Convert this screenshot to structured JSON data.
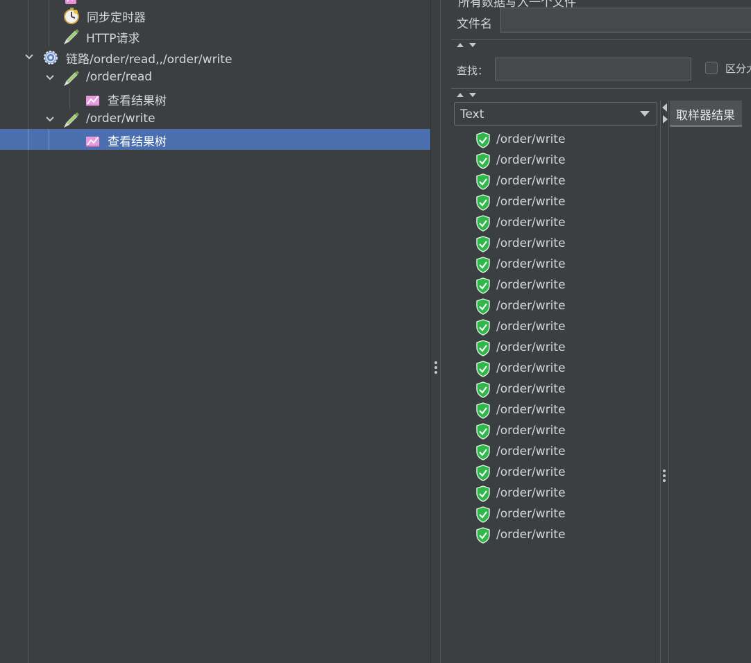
{
  "tree": {
    "nodes": [
      {
        "label": "",
        "icon": "listener-icon"
      },
      {
        "label": "同步定时器",
        "icon": "timer-icon"
      },
      {
        "label": "HTTP请求",
        "icon": "sampler-pen-icon"
      },
      {
        "label": "链路/order/read,,/order/write",
        "icon": "gear-icon",
        "expanded": true
      },
      {
        "label": "/order/read",
        "icon": "sampler-pen-icon",
        "expanded": true
      },
      {
        "label": "查看结果树",
        "icon": "results-tree-icon"
      },
      {
        "label": "/order/write",
        "icon": "sampler-pen-icon",
        "expanded": true
      },
      {
        "label": "查看结果树",
        "icon": "results-tree-icon",
        "selected": true
      }
    ]
  },
  "file": {
    "title_partial": "所有数据写入一个文件",
    "label": "文件名",
    "value": ""
  },
  "search": {
    "label": "查找：",
    "value": "",
    "case_label": "区分大"
  },
  "renderer": {
    "selected": "Text"
  },
  "results": {
    "items": [
      "/order/write",
      "/order/write",
      "/order/write",
      "/order/write",
      "/order/write",
      "/order/write",
      "/order/write",
      "/order/write",
      "/order/write",
      "/order/write",
      "/order/write",
      "/order/write",
      "/order/write",
      "/order/write",
      "/order/write",
      "/order/write",
      "/order/write",
      "/order/write",
      "/order/write",
      "/order/write"
    ],
    "status_icon": "success-shield-icon"
  },
  "detail": {
    "tab_label": "取样器结果"
  },
  "colors": {
    "background": "#3c3f41",
    "selection": "#4b6eaf",
    "success": "#2fb84a"
  }
}
